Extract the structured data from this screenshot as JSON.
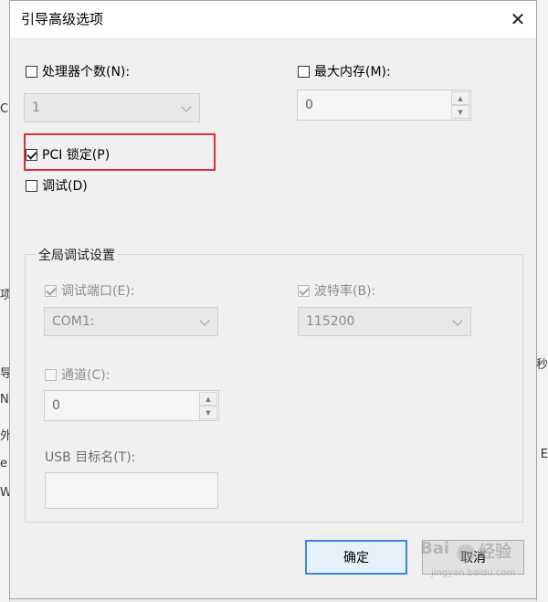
{
  "dialog": {
    "title": "引导高级选项",
    "close_icon": "close-icon"
  },
  "processors": {
    "label": "处理器个数(N):",
    "checked": false,
    "value": "1"
  },
  "max_memory": {
    "label": "最大内存(M):",
    "checked": false,
    "value": "0"
  },
  "pci_lock": {
    "label": "PCI 锁定(P)",
    "checked": true
  },
  "debug": {
    "label": "调试(D)",
    "checked": false
  },
  "global_debug": {
    "title": "全局调试设置",
    "port_label": "调试端口(E):",
    "port_value": "COM1:",
    "baud_label": "波特率(B):",
    "baud_value": "115200",
    "channel_label": "通道(C):",
    "channel_value": "0",
    "usb_label": "USB 目标名(T):",
    "usb_value": ""
  },
  "buttons": {
    "ok": "确定",
    "cancel": "取消"
  },
  "background": {
    "left_fragments": [
      "C",
      "项",
      "导",
      "N",
      "外",
      "e",
      "W"
    ],
    "right_fragments": [
      "秒",
      "E"
    ]
  },
  "watermark": {
    "brand": "Bai",
    "suffix": "经验",
    "url": "jingyan.baidu.com"
  },
  "colors": {
    "highlight_box": "#d9303a",
    "default_button_border": "#3b86d8"
  }
}
